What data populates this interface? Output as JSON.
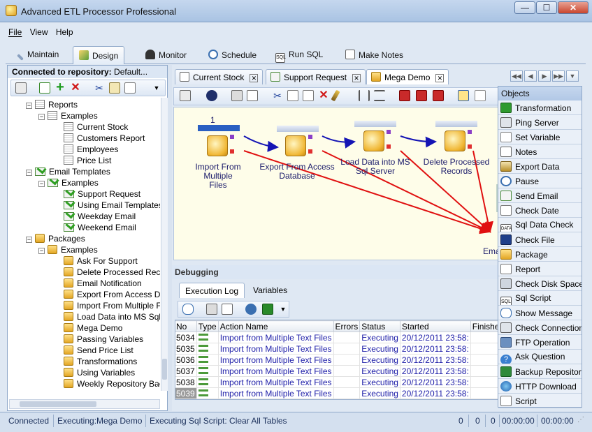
{
  "window": {
    "title": "Advanced ETL Processor Professional",
    "min_label": "—",
    "max_label": "☐",
    "close_label": "✕"
  },
  "menu": [
    "File",
    "View",
    "Help"
  ],
  "main_tabs": [
    "Maintain",
    "Design",
    "Monitor",
    "Schedule",
    "Run SQL",
    "Make Notes"
  ],
  "repository": {
    "label": "Connected to repository:",
    "name": "Default..."
  },
  "tree": [
    {
      "label": "Reports"
    },
    {
      "label": "Examples"
    },
    {
      "label": "Current Stock"
    },
    {
      "label": "Customers Report"
    },
    {
      "label": "Employees"
    },
    {
      "label": "Price List"
    },
    {
      "label": "Email Templates"
    },
    {
      "label": "Examples"
    },
    {
      "label": "Support Request"
    },
    {
      "label": "Using Email Templates"
    },
    {
      "label": "Weekday Email"
    },
    {
      "label": "Weekend Email"
    },
    {
      "label": "Packages"
    },
    {
      "label": "Examples"
    },
    {
      "label": "Ask For Support"
    },
    {
      "label": "Delete Processed Reco"
    },
    {
      "label": "Email Notification"
    },
    {
      "label": "Export From Access Da"
    },
    {
      "label": "Import From Multiple Fi"
    },
    {
      "label": "Load Data into MS Sql S"
    },
    {
      "label": "Mega Demo"
    },
    {
      "label": "Passing Variables"
    },
    {
      "label": "Send Price List"
    },
    {
      "label": "Transformations"
    },
    {
      "label": "Using Variables"
    },
    {
      "label": "Weekly Repository Bac"
    }
  ],
  "doc_tabs": [
    "Current Stock",
    "Support Request",
    "Mega Demo"
  ],
  "canvas": {
    "step_number": "1",
    "nodes": [
      {
        "label_1": "Import From Multiple",
        "label_2": "Files"
      },
      {
        "label_1": "Export From Access",
        "label_2": "Database"
      },
      {
        "label_1": "Load Data into MS",
        "label_2": "Sql Server"
      },
      {
        "label_1": "Delete Processed",
        "label_2": "Records"
      },
      {
        "label_1": "Ema",
        "label_2": ""
      }
    ]
  },
  "debugging": {
    "title": "Debugging",
    "tabs": [
      "Execution Log",
      "Variables"
    ],
    "columns": [
      "No",
      "Type",
      "Action Name",
      "Errors",
      "Status",
      "Started",
      "Finished"
    ],
    "rows": [
      {
        "no": "5034",
        "action": "Import from Multiple Text Files",
        "errors": "",
        "status": "Executing",
        "started": "20/12/2011 23:58:",
        "finished": ""
      },
      {
        "no": "5035",
        "action": "Import from Multiple Text Files",
        "errors": "",
        "status": "Executing",
        "started": "20/12/2011 23:58:",
        "finished": ""
      },
      {
        "no": "5036",
        "action": "Import from Multiple Text Files",
        "errors": "",
        "status": "Executing",
        "started": "20/12/2011 23:58:",
        "finished": ""
      },
      {
        "no": "5037",
        "action": "Import from Multiple Text Files",
        "errors": "",
        "status": "Executing",
        "started": "20/12/2011 23:58:",
        "finished": ""
      },
      {
        "no": "5038",
        "action": "Import from Multiple Text Files",
        "errors": "",
        "status": "Executing",
        "started": "20/12/2011 23:58:",
        "finished": ""
      },
      {
        "no": "5039",
        "action": "Import from Multiple Text Files",
        "errors": "",
        "status": "Executing",
        "started": "20/12/2011 23:58:",
        "finished": ""
      }
    ]
  },
  "objects": {
    "title": "Objects",
    "items": [
      "Transformation",
      "Ping Server",
      "Set Variable",
      "Notes",
      "Export Data",
      "Pause",
      "Send Email",
      "Check Date",
      "Sql Data Check",
      "Check File",
      "Package",
      "Report",
      "Check Disk Space",
      "Sql Script",
      "Show Message",
      "Check Connection",
      "FTP Operation",
      "Ask Question",
      "Backup Repository",
      "HTTP Download",
      "Script"
    ]
  },
  "status": {
    "connection": "Connected",
    "executing": "Executing:Mega Demo",
    "script": "Executing Sql Script: Clear All Tables",
    "count_1": "0",
    "count_2": "0",
    "count_3": "0",
    "time_1": "00:00:00",
    "time_2": "00:00:00"
  },
  "colors": {
    "flow_success": "#1414b4",
    "flow_error": "#e01010",
    "title_bar": "#b7cde8"
  }
}
